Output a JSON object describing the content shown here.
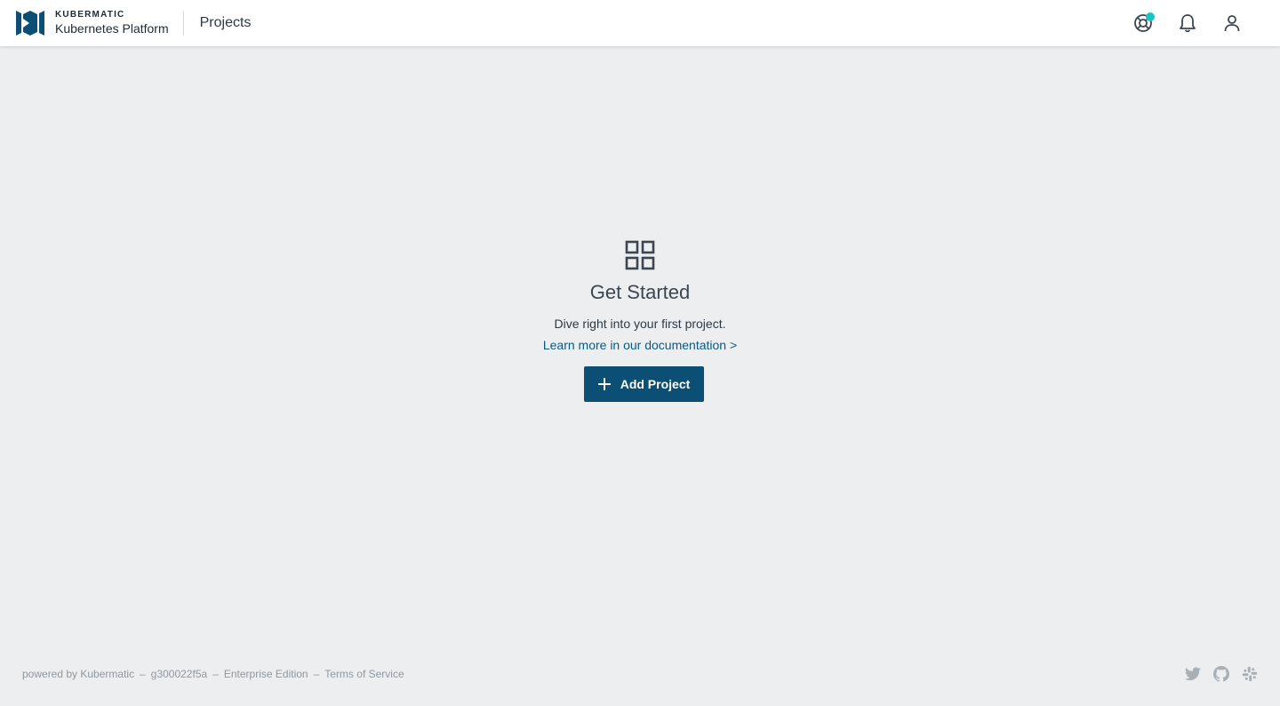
{
  "header": {
    "brand_company": "KUBERMATIC",
    "brand_product": "Kubernetes Platform",
    "page_title": "Projects",
    "actions": [
      {
        "icon": "help-icon",
        "badge": true
      },
      {
        "icon": "bell-icon"
      },
      {
        "icon": "user-icon"
      }
    ]
  },
  "empty_state": {
    "icon": "grid-icon",
    "title": "Get Started",
    "subtitle": "Dive right into your first project.",
    "link": "Learn more in our documentation >",
    "button": "Add Project"
  },
  "footer": {
    "powered_by": "powered by Kubermatic",
    "version": "g300022f5a",
    "edition": "Enterprise Edition",
    "terms": "Terms of Service",
    "separator": "–",
    "social": [
      "twitter-icon",
      "github-icon",
      "slack-icon"
    ]
  },
  "colors": {
    "primary": "#0c4f74",
    "link": "#0a5a82",
    "badge": "#1bc4c4",
    "background": "#edeef0"
  }
}
